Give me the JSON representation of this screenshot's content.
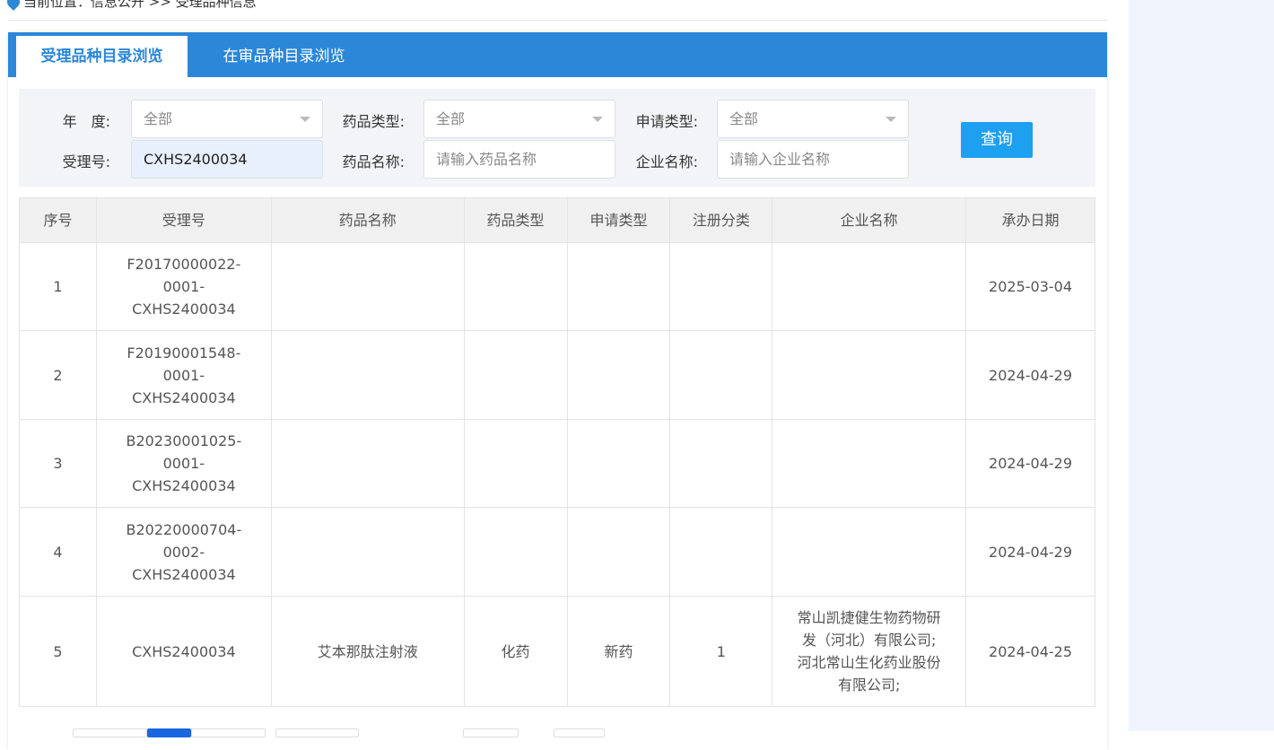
{
  "breadcrumb": "当前位置：信息公开 >> 受理品种信息",
  "tabs": [
    {
      "label": "受理品种目录浏览"
    },
    {
      "label": "在审品种目录浏览"
    }
  ],
  "filters": {
    "year_label": "年　度:",
    "year_value": "全部",
    "drug_type_label": "药品类型:",
    "drug_type_value": "全部",
    "apply_type_label": "申请类型:",
    "apply_type_value": "全部",
    "accept_no_label": "受理号:",
    "accept_no_value": "CXHS2400034",
    "drug_name_label": "药品名称:",
    "drug_name_placeholder": "请输入药品名称",
    "company_label": "企业名称:",
    "company_placeholder": "请输入企业名称",
    "query_button": "查询"
  },
  "table": {
    "headers": [
      "序号",
      "受理号",
      "药品名称",
      "药品类型",
      "申请类型",
      "注册分类",
      "企业名称",
      "承办日期"
    ],
    "rows": [
      [
        "1",
        "F20170000022-\n0001-\nCXHS2400034",
        "",
        "",
        "",
        "",
        "",
        "2025-03-04"
      ],
      [
        "2",
        "F20190001548-\n0001-\nCXHS2400034",
        "",
        "",
        "",
        "",
        "",
        "2024-04-29"
      ],
      [
        "3",
        "B20230001025-\n0001-\nCXHS2400034",
        "",
        "",
        "",
        "",
        "",
        "2024-04-29"
      ],
      [
        "4",
        "B20220000704-\n0002-\nCXHS2400034",
        "",
        "",
        "",
        "",
        "",
        "2024-04-29"
      ],
      [
        "5",
        "CXHS2400034",
        "艾本那肽注射液",
        "化药",
        "新药",
        "1",
        "常山凯捷健生物药物研\n发（河北）有限公司;\n河北常山生化药业股份\n有限公司;",
        "2024-04-25"
      ]
    ]
  },
  "colors": {
    "accent": "#2b87d8",
    "button": "#1ea0f0"
  }
}
